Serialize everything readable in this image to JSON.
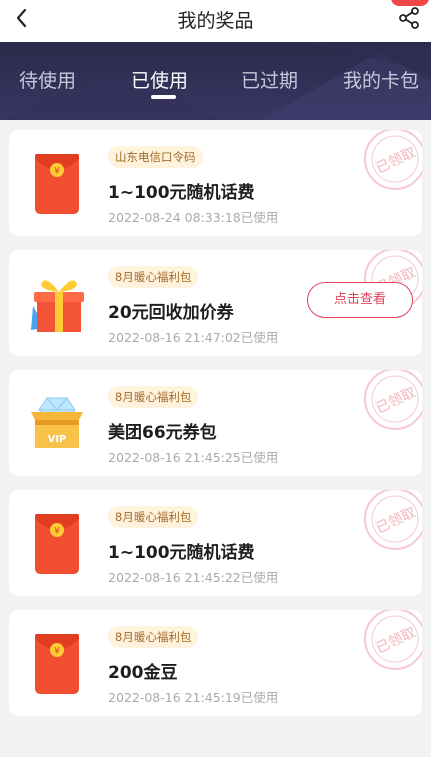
{
  "header": {
    "title": "我的奖品"
  },
  "tabs": [
    {
      "label": "待使用",
      "active": false
    },
    {
      "label": "已使用",
      "active": true
    },
    {
      "label": "已过期",
      "active": false
    },
    {
      "label": "我的卡包",
      "active": false
    }
  ],
  "stamp_text": "已领取",
  "prizes": [
    {
      "icon": "red-envelope-icon",
      "tag": "山东电信口令码",
      "name": "1~100元随机话费",
      "time": "2022-08-24 08:33:18已使用"
    },
    {
      "icon": "gift-box-icon",
      "tag": "8月暖心福利包",
      "name": "20元回收加价券",
      "time": "2022-08-16 21:47:02已使用",
      "button": "点击查看"
    },
    {
      "icon": "vip-chest-icon",
      "tag": "8月暖心福利包",
      "name": "美团66元券包",
      "time": "2022-08-16 21:45:25已使用",
      "vip_label": "VIP"
    },
    {
      "icon": "red-envelope-icon",
      "tag": "8月暖心福利包",
      "name": "1~100元随机话费",
      "time": "2022-08-16 21:45:22已使用"
    },
    {
      "icon": "red-envelope-icon",
      "tag": "8月暖心福利包",
      "name": "200金豆",
      "time": "2022-08-16 21:45:19已使用"
    }
  ],
  "colors": {
    "tab_bg": "#2b2a4a",
    "accent": "#e0445a",
    "envelope": "#f0502f",
    "tag_bg": "#fff3dd"
  }
}
